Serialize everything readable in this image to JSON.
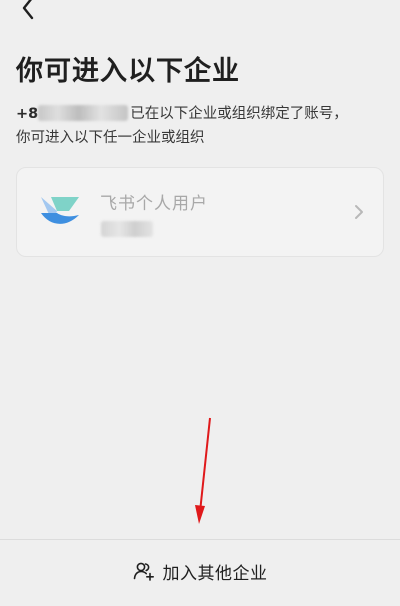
{
  "header": {
    "back_icon": "chevron-left-icon"
  },
  "page": {
    "title": "你可进入以下企业",
    "subtitle_phone_prefix": "+8",
    "subtitle_line1": "已在以下企业或组织绑定了账号，",
    "subtitle_line2": "你可进入以下任一企业或组织"
  },
  "organizations": [
    {
      "name": "飞书个人用户",
      "logo_icon": "feishu-logo-icon",
      "action_icon": "chevron-right-icon"
    }
  ],
  "footer": {
    "join_icon": "add-user-icon",
    "join_label": "加入其他企业"
  },
  "colors": {
    "background": "#efefef",
    "text_primary": "#1f1f1f",
    "text_muted": "#a8a8a8",
    "annotation_arrow": "#e0191b",
    "logo_dark_blue": "#3e8fe0",
    "logo_light_blue": "#a3c8f0",
    "logo_teal": "#7fd3c8"
  }
}
